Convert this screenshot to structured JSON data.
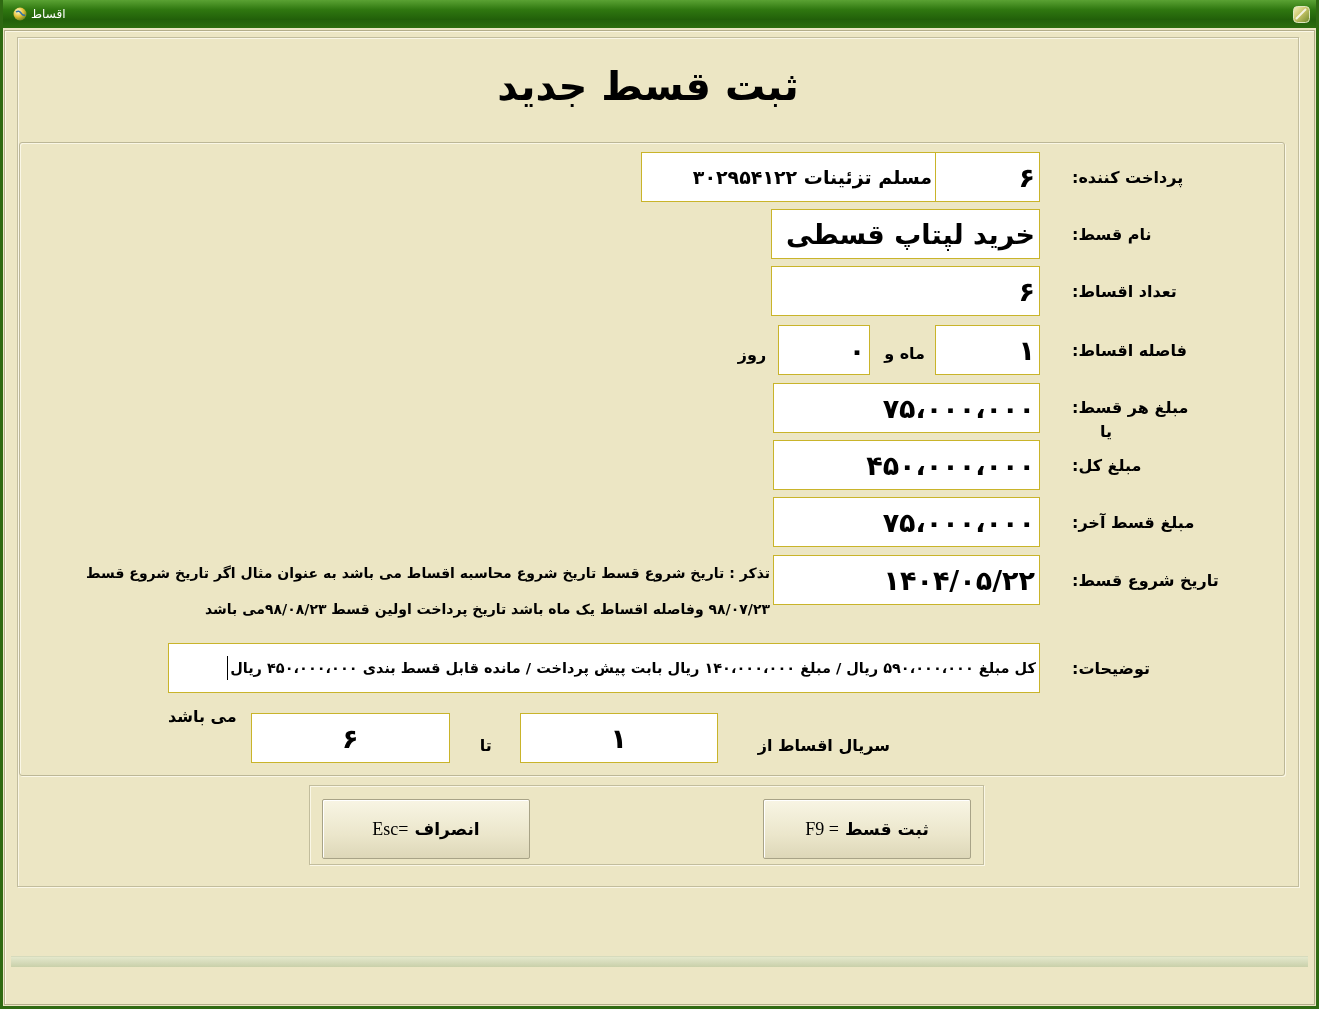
{
  "window": {
    "title": "اقساط"
  },
  "form": {
    "title": "ثبت قسط جدید",
    "payer": {
      "label": "پرداخت کننده:",
      "code": "۶",
      "name": "مسلم تزئینات ۳۰۲۹۵۴۱۲۲"
    },
    "installment_name": {
      "label": "نام قسط:",
      "value": "خرید لپتاپ قسطی"
    },
    "installment_count": {
      "label": "تعداد اقساط:",
      "value": "۶"
    },
    "interval": {
      "label": "فاصله اقساط:",
      "months": "۱",
      "months_unit": "ماه و",
      "days": "۰",
      "days_unit": "روز"
    },
    "amount_each": {
      "label": "مبلغ هر قسط:",
      "value": "۷۵،۰۰۰،۰۰۰",
      "or_text": "یا"
    },
    "amount_total": {
      "label": "مبلغ کل:",
      "value": "۴۵۰،۰۰۰،۰۰۰"
    },
    "last_amount": {
      "label": "مبلغ قسط آخر:",
      "value": "۷۵،۰۰۰،۰۰۰"
    },
    "start_date": {
      "label": "تاریخ شروع قسط:",
      "value": "۱۴۰۴/۰۵/۲۲",
      "note": "تذکر : تاریخ شروع قسط تاریخ شروع محاسبه اقساط  می باشد به عنوان مثال اگر تاریخ شروع قسط ۹۸/۰۷/۲۳ وفاصله اقساط یک ماه باشد تاریخ پرداخت اولین قسط ۹۸/۰۸/۲۳می باشد"
    },
    "description": {
      "label": "توضیحات:",
      "value": "کل مبلغ ۵۹۰،۰۰۰،۰۰۰ ریال / مبلغ ۱۴۰،۰۰۰،۰۰۰ ریال بابت پیش پرداخت / مانده قابل قسط بندی ۴۵۰،۰۰۰،۰۰۰ ریال",
      "focused": true
    },
    "serial": {
      "label": "سریال اقساط از",
      "from": "۱",
      "to_label": "تا",
      "to": "۶",
      "suffix": "می باشد"
    }
  },
  "buttons": [
    {
      "label": "ثبت قسط",
      "shortcut": "= F9"
    },
    {
      "label": "انصراف",
      "shortcut": "=Esc"
    }
  ]
}
